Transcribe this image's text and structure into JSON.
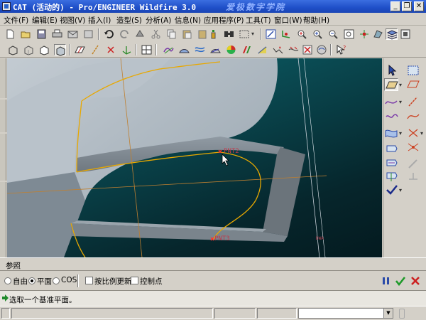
{
  "window": {
    "title": "CAT (活动的) - Pro/ENGINEER Wildfire 3.0",
    "watermark": "爱极数字学院",
    "buttons": {
      "minimize": "_",
      "restore": "❐",
      "close": "✕"
    }
  },
  "menu": [
    "文件(F)",
    "编辑(E)",
    "视图(V)",
    "插入(I)",
    "造型(S)",
    "分析(A)",
    "信息(N)",
    "应用程序(P)",
    "工具(T)",
    "窗口(W)",
    "帮助(H)"
  ],
  "viewport": {
    "point_labels": [
      "PNT2",
      "PNT3"
    ],
    "small_label": "DWA"
  },
  "dashboard": {
    "tab_label": "参照",
    "options": {
      "free": "自由",
      "plane": "平面",
      "cos": "COS",
      "selected": "plane"
    },
    "checkboxes": {
      "proportional_update": "按比例更新",
      "control_points": "控制点"
    }
  },
  "message": "选取一个基准平面。",
  "colors": {
    "titlebar": "#1f4fc8",
    "chrome": "#d4d0c8",
    "viewport_bg": "#0a4a52",
    "part_surface": "#a9b4bd",
    "datum_line": "#d89a2a",
    "curve": "#e8a800",
    "confirm": "#1f9a2a",
    "cancel": "#cc2020",
    "pause": "#2a4aa8"
  },
  "icons": {
    "toolbar_row1": [
      "new-icon",
      "open-icon",
      "save-icon",
      "print-icon",
      "email-icon",
      "send-icon",
      "undo-icon",
      "redo-icon",
      "regenerate-icon",
      "cut-icon",
      "copy-icon",
      "paste-icon",
      "paste-special-icon",
      "model-tree-icon",
      "search-icon",
      "select-box-icon",
      "sketch-icon",
      "csys-icon",
      "orient-icon",
      "zoom-in-icon",
      "zoom-out-icon",
      "refit-icon",
      "spin-center-icon",
      "saved-views-icon",
      "layers-icon",
      "display-style-icon"
    ],
    "toolbar_row2": [
      "wireframe-icon",
      "hidden-line-icon",
      "no-hidden-icon",
      "shading-icon",
      "plane-display-icon",
      "axis-display-icon",
      "point-display-icon",
      "csys-display-icon",
      "view-manager-icon",
      "curve-analysis-icon",
      "surface-analysis-icon",
      "reflection-icon",
      "shaded-curvature-icon",
      "draft-icon",
      "slope-icon",
      "normal-icon",
      "deviation-icon",
      "whats-this-icon"
    ],
    "right_toolbar": [
      "select-icon",
      "style-surface-icon",
      "plane-icon",
      "trim-icon",
      "curve-icon",
      "line-icon",
      "free-curve-icon",
      "curve-edit-icon",
      "surface-icon",
      "connect-icon",
      "trim-curve-icon",
      "split-icon",
      "curve-on-surface-icon",
      "offset-icon",
      "project-icon",
      "drop-icon",
      "done-icon"
    ]
  }
}
